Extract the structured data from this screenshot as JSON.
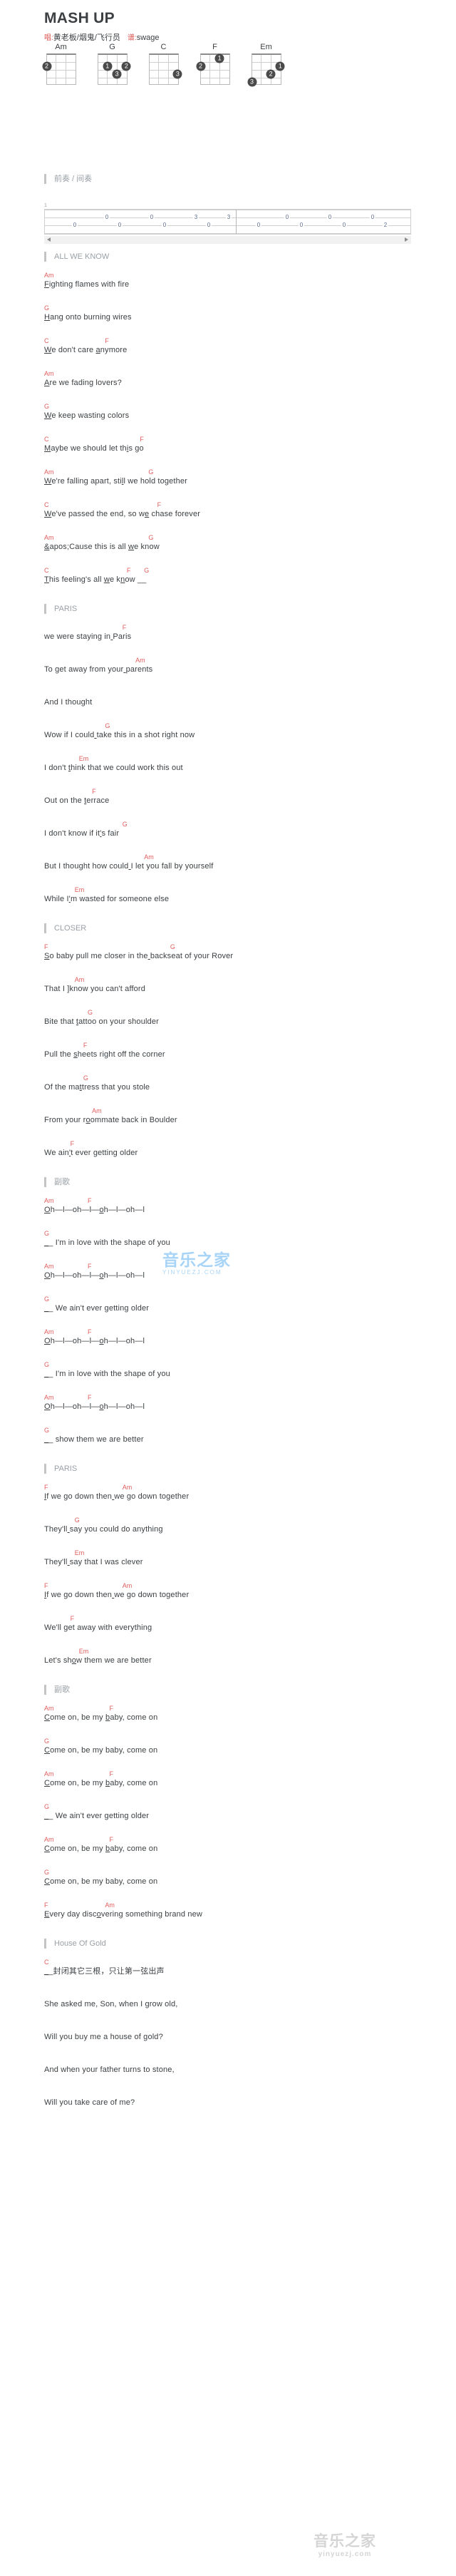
{
  "header": {
    "title": "MASH UP",
    "singer_label": "唱:",
    "singer": "黄老板/烟鬼/飞行员",
    "arranger_label": "谱:",
    "arranger": "swage"
  },
  "chords": [
    {
      "name": "Am",
      "dots": [
        {
          "label": "2",
          "string": 1,
          "fret": 2
        }
      ]
    },
    {
      "name": "G",
      "dots": [
        {
          "label": "1",
          "string": 2,
          "fret": 2
        },
        {
          "label": "2",
          "string": 4,
          "fret": 2
        },
        {
          "label": "3",
          "string": 3,
          "fret": 3
        }
      ]
    },
    {
      "name": "C",
      "dots": [
        {
          "label": "3",
          "string": 4,
          "fret": 3
        }
      ]
    },
    {
      "name": "F",
      "dots": [
        {
          "label": "1",
          "string": 3,
          "fret": 1
        },
        {
          "label": "2",
          "string": 1,
          "fret": 2
        }
      ]
    },
    {
      "name": "Em",
      "dots": [
        {
          "label": "1",
          "string": 4,
          "fret": 2
        },
        {
          "label": "2",
          "string": 3,
          "fret": 3
        },
        {
          "label": "3",
          "string": 1,
          "fret": 4
        }
      ]
    }
  ],
  "intro": {
    "section_label": "前奏 / 间奏",
    "measure_number": "1",
    "tab": {
      "measure1_string1": [
        "0",
        "0",
        "3",
        "3"
      ],
      "measure1_string2": [
        "0",
        "0",
        "0",
        "0"
      ],
      "measure2_string1": [
        "0",
        "0",
        "0"
      ],
      "measure2_string2": [
        "0",
        "0",
        "0",
        "2"
      ]
    }
  },
  "sections": [
    {
      "label": "ALL WE KNOW"
    },
    {
      "label": "PARIS"
    },
    {
      "label": "CLOSER"
    },
    {
      "label": "副歌"
    },
    {
      "label": "PARIS"
    },
    {
      "label": "副歌"
    },
    {
      "label": "House Of Gold"
    }
  ],
  "lines": [
    {
      "text": "Fighting flames with fire",
      "chords": [
        {
          "name": "Am",
          "at": 0
        }
      ]
    },
    {
      "text": "Hang onto burning wires",
      "chords": [
        {
          "name": "G",
          "at": 0
        }
      ]
    },
    {
      "text": "We don't care anymore",
      "chords": [
        {
          "name": "C",
          "at": 0
        },
        {
          "name": "F",
          "at": 14
        }
      ]
    },
    {
      "text": "Are we fading lovers?",
      "chords": [
        {
          "name": "Am",
          "at": 0
        }
      ]
    },
    {
      "text": "We keep wasting colors",
      "chords": [
        {
          "name": "G",
          "at": 0
        }
      ]
    },
    {
      "text": "Maybe we should let this go",
      "chords": [
        {
          "name": "C",
          "at": 0
        },
        {
          "name": "F",
          "at": 22
        }
      ]
    },
    {
      "text": "We're falling apart, still we hold together",
      "chords": [
        {
          "name": "Am",
          "at": 0
        },
        {
          "name": "G",
          "at": 24
        }
      ]
    },
    {
      "text": "We've passed the end, so we chase forever",
      "chords": [
        {
          "name": "C",
          "at": 0
        },
        {
          "name": "F",
          "at": 26
        }
      ]
    },
    {
      "text": "&apos;Cause this is all we know",
      "chords": [
        {
          "name": "Am",
          "at": 0
        },
        {
          "name": "G",
          "at": 24
        }
      ]
    },
    {
      "text": "This feeling's all we know __",
      "chords": [
        {
          "name": "C",
          "at": 0
        },
        {
          "name": "F",
          "at": 19
        },
        {
          "name": "G",
          "at": 23
        }
      ]
    },
    {
      "text": "we were staying in Paris",
      "chords": [
        {
          "name": "F",
          "at": 18
        }
      ]
    },
    {
      "text": "To get away from your parents",
      "chords": [
        {
          "name": "Am",
          "at": 21
        }
      ]
    },
    {
      "text": "And I thought",
      "chords": []
    },
    {
      "text": "Wow if I could take this in a shot right now",
      "chords": [
        {
          "name": "G",
          "at": 14
        }
      ]
    },
    {
      "text": "I don't think that we could work this out",
      "chords": [
        {
          "name": "Em",
          "at": 8
        }
      ]
    },
    {
      "text": "Out on the terrace",
      "chords": [
        {
          "name": "F",
          "at": 11
        }
      ]
    },
    {
      "text": "I don't know if it's fair",
      "chords": [
        {
          "name": "G",
          "at": 18
        }
      ]
    },
    {
      "text": "But I thought how could I let you fall by yourself",
      "chords": [
        {
          "name": "Am",
          "at": 23
        }
      ]
    },
    {
      "text": "While I'm wasted for someone else",
      "chords": [
        {
          "name": "Em",
          "at": 7
        }
      ]
    },
    {
      "text": "So baby pull me closer in the backseat of your Rover",
      "chords": [
        {
          "name": "F",
          "at": 0
        },
        {
          "name": "G",
          "at": 29
        }
      ]
    },
    {
      "text": "That I ]know you can't afford",
      "chords": [
        {
          "name": "Am",
          "at": 7
        }
      ]
    },
    {
      "text": "Bite that tattoo on your shoulder",
      "chords": [
        {
          "name": "G",
          "at": 10
        }
      ]
    },
    {
      "text": "Pull the sheets right off the corner",
      "chords": [
        {
          "name": "F",
          "at": 9
        }
      ]
    },
    {
      "text": "Of the mattress that you stole",
      "chords": [
        {
          "name": "G",
          "at": 9
        }
      ]
    },
    {
      "text": "From your roommate back in Boulder",
      "chords": [
        {
          "name": "Am",
          "at": 11
        }
      ]
    },
    {
      "text": "We ain't ever getting older",
      "chords": [
        {
          "name": "F",
          "at": 6
        }
      ]
    },
    {
      "text": "Oh—l—oh—l—oh—l—oh—l",
      "chords": [
        {
          "name": "Am",
          "at": 0
        },
        {
          "name": "F",
          "at": 10
        }
      ]
    },
    {
      "text": "__ I'm in love with the shape of you",
      "chords": [
        {
          "name": "G",
          "at": 0
        }
      ]
    },
    {
      "text": "Oh—l—oh—l—oh—l—oh—l",
      "chords": [
        {
          "name": "Am",
          "at": 0
        },
        {
          "name": "F",
          "at": 10
        }
      ]
    },
    {
      "text": "__ We ain't ever getting older",
      "chords": [
        {
          "name": "G",
          "at": 0
        }
      ]
    },
    {
      "text": "Oh—l—oh—l—oh—l—oh—l",
      "chords": [
        {
          "name": "Am",
          "at": 0
        },
        {
          "name": "F",
          "at": 10
        }
      ]
    },
    {
      "text": "__ I'm in love with the shape of you",
      "chords": [
        {
          "name": "G",
          "at": 0
        }
      ]
    },
    {
      "text": "Oh—l—oh—l—oh—l—oh—l",
      "chords": [
        {
          "name": "Am",
          "at": 0
        },
        {
          "name": "F",
          "at": 10
        }
      ]
    },
    {
      "text": "__ show them we are better",
      "chords": [
        {
          "name": "G",
          "at": 0
        }
      ]
    },
    {
      "text": "If we go down then we go down together",
      "chords": [
        {
          "name": "F",
          "at": 0
        },
        {
          "name": "Am",
          "at": 18
        }
      ]
    },
    {
      "text": "They'll say you could do anything",
      "chords": [
        {
          "name": "G",
          "at": 7
        }
      ]
    },
    {
      "text": "They'll say that I was clever",
      "chords": [
        {
          "name": "Em",
          "at": 7
        }
      ]
    },
    {
      "text": "If we go down then we go down together",
      "chords": [
        {
          "name": "F",
          "at": 0
        },
        {
          "name": "Am",
          "at": 18
        }
      ]
    },
    {
      "text": "We'll get away with everything",
      "chords": [
        {
          "name": "F",
          "at": 6
        }
      ]
    },
    {
      "text": "Let's show them we are better",
      "chords": [
        {
          "name": "Em",
          "at": 8
        }
      ]
    },
    {
      "text": "Come on, be my baby, come on",
      "chords": [
        {
          "name": "Am",
          "at": 0
        },
        {
          "name": "F",
          "at": 15
        }
      ]
    },
    {
      "text": "Come on, be my baby, come on",
      "chords": [
        {
          "name": "G",
          "at": 0
        }
      ]
    },
    {
      "text": "Come on, be my baby, come on",
      "chords": [
        {
          "name": "Am",
          "at": 0
        },
        {
          "name": "F",
          "at": 15
        }
      ]
    },
    {
      "text": "__ We ain't ever getting older",
      "chords": [
        {
          "name": "G",
          "at": 0
        }
      ]
    },
    {
      "text": "Come on, be my baby, come on",
      "chords": [
        {
          "name": "Am",
          "at": 0
        },
        {
          "name": "F",
          "at": 15
        }
      ]
    },
    {
      "text": "Come on, be my baby, come on",
      "chords": [
        {
          "name": "G",
          "at": 0
        }
      ]
    },
    {
      "text": "Every day discovering something brand new",
      "chords": [
        {
          "name": "F",
          "at": 0
        },
        {
          "name": "Am",
          "at": 14
        }
      ]
    },
    {
      "text": "__封闭其它三根，只让第一弦出声",
      "chords": [
        {
          "name": "C",
          "at": 0
        }
      ]
    },
    {
      "text": "She asked me, Son, when I grow old,",
      "chords": []
    },
    {
      "text": "Will you buy me a house of gold?",
      "chords": []
    },
    {
      "text": "And when your father turns to stone,",
      "chords": []
    },
    {
      "text": "Will you take care of me?",
      "chords": []
    }
  ],
  "watermark": {
    "mid_text": "音乐之家",
    "mid_sub": "YINYUEZJ.COM",
    "foot_text": "音乐之家",
    "foot_sub": "yinyuezj.com"
  },
  "colors": {
    "chord": "#e05c5c",
    "section": "#9aa0a6",
    "text": "#3c4043",
    "watermark_mid": "#a8d4f7",
    "watermark_foot": "#d5d5d5"
  }
}
